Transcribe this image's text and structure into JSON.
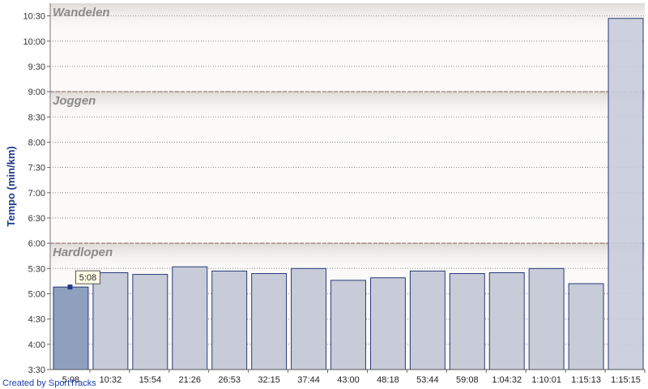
{
  "chart_data": {
    "type": "bar",
    "ylabel": "Tempo (min/km)",
    "y_unit": "min:sec per km",
    "y_tick_labels": [
      "3:30",
      "4:00",
      "4:30",
      "5:00",
      "5:30",
      "6:00",
      "6:30",
      "7:00",
      "7:30",
      "8:00",
      "8:30",
      "9:00",
      "9:30",
      "10:00",
      "10:30"
    ],
    "ylim": [
      "3:30",
      "10:45"
    ],
    "grid": true,
    "categories": [
      "5:08",
      "10:32",
      "15:54",
      "21:26",
      "26:53",
      "32:15",
      "37:44",
      "43:00",
      "48:18",
      "53:44",
      "59:08",
      "1:04:32",
      "1:10:01",
      "1:15:13",
      "1:15:15"
    ],
    "values": [
      "5:08",
      "5:25",
      "5:23",
      "5:32",
      "5:27",
      "5:24",
      "5:30",
      "5:16",
      "5:19",
      "5:27",
      "5:24",
      "5:25",
      "5:30",
      "5:12",
      "10:27"
    ],
    "highlighted_index": 0,
    "callout": "5:08",
    "zones": [
      {
        "name": "Wandelen",
        "from": "9:00",
        "to": "10:45"
      },
      {
        "name": "Joggen",
        "from": "6:00",
        "to": "9:00"
      },
      {
        "name": "Hardlopen",
        "from": "3:30",
        "to": "6:00"
      }
    ],
    "colors": {
      "bar_fill": "#c8ccd9",
      "bar_highlight": "#8fa0bf",
      "bar_stroke": "#283a7a",
      "zone_band_top": "#dedad6",
      "zone_divider": "#a07878",
      "grid": "#8a8a8a",
      "axis_label": "#1f3a8a"
    }
  },
  "footer": {
    "credit": "Created by SportTracks"
  }
}
